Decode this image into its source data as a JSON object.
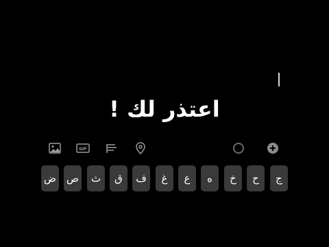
{
  "story": {
    "text": "اعتذر لك !"
  },
  "toolbar": {
    "left_tools": [
      "image-icon",
      "gif-icon",
      "text-align-icon",
      "location-icon"
    ],
    "right_tools": [
      "circle-icon",
      "add-icon"
    ]
  },
  "keyboard": {
    "row1": [
      "ض",
      "ص",
      "ث",
      "ق",
      "ف",
      "غ",
      "ع",
      "ه",
      "خ",
      "ح",
      "ج"
    ]
  },
  "colors": {
    "background": "#000000",
    "key": "#3a3a3c",
    "text": "#ffffff",
    "icon": "#9a9a9a"
  }
}
